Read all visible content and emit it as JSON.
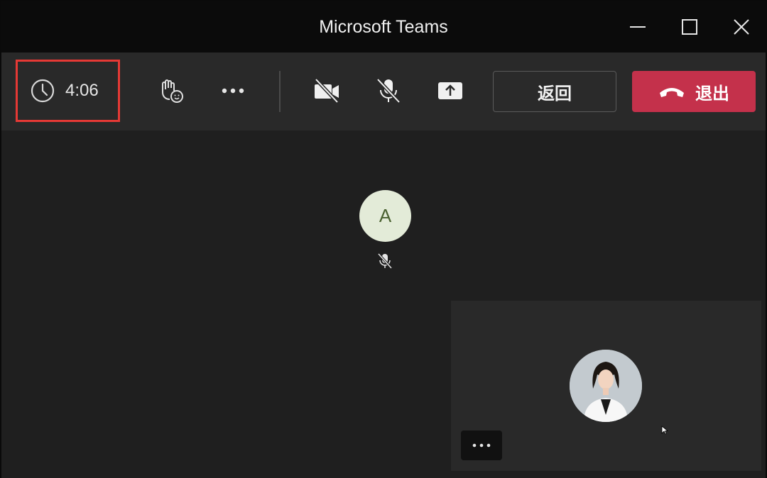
{
  "window": {
    "title": "Microsoft Teams"
  },
  "toolbar": {
    "timer": "4:06",
    "back_label": "返回",
    "leave_label": "退出"
  },
  "stage": {
    "participant_initial": "A"
  },
  "colors": {
    "leave_button": "#c4314b",
    "timer_highlight": "#e53935",
    "avatar_bg": "#e3ebd8"
  }
}
